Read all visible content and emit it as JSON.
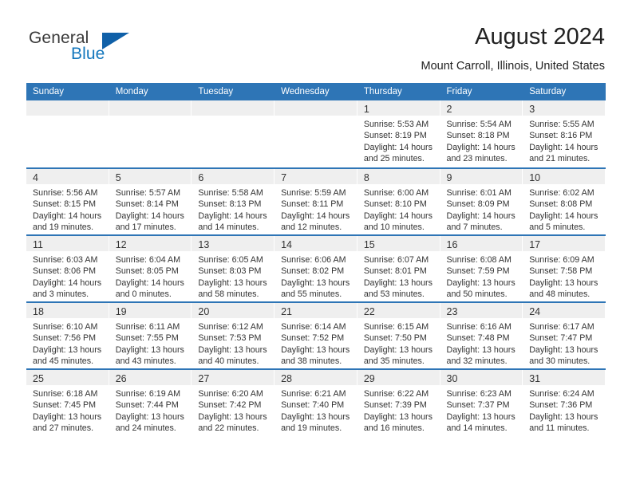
{
  "brand": {
    "name_part1": "General",
    "name_part2": "Blue",
    "mark": "triangle-logo"
  },
  "header": {
    "title": "August 2024",
    "location": "Mount Carroll, Illinois, United States"
  },
  "calendar": {
    "weekday_headers": [
      "Sunday",
      "Monday",
      "Tuesday",
      "Wednesday",
      "Thursday",
      "Friday",
      "Saturday"
    ],
    "accent_color": "#2e75b6",
    "daynum_band_color": "#efefef",
    "weeks": [
      [
        {
          "day": "",
          "lines": []
        },
        {
          "day": "",
          "lines": []
        },
        {
          "day": "",
          "lines": []
        },
        {
          "day": "",
          "lines": []
        },
        {
          "day": "1",
          "lines": [
            "Sunrise: 5:53 AM",
            "Sunset: 8:19 PM",
            "Daylight: 14 hours",
            "and 25 minutes."
          ]
        },
        {
          "day": "2",
          "lines": [
            "Sunrise: 5:54 AM",
            "Sunset: 8:18 PM",
            "Daylight: 14 hours",
            "and 23 minutes."
          ]
        },
        {
          "day": "3",
          "lines": [
            "Sunrise: 5:55 AM",
            "Sunset: 8:16 PM",
            "Daylight: 14 hours",
            "and 21 minutes."
          ]
        }
      ],
      [
        {
          "day": "4",
          "lines": [
            "Sunrise: 5:56 AM",
            "Sunset: 8:15 PM",
            "Daylight: 14 hours",
            "and 19 minutes."
          ]
        },
        {
          "day": "5",
          "lines": [
            "Sunrise: 5:57 AM",
            "Sunset: 8:14 PM",
            "Daylight: 14 hours",
            "and 17 minutes."
          ]
        },
        {
          "day": "6",
          "lines": [
            "Sunrise: 5:58 AM",
            "Sunset: 8:13 PM",
            "Daylight: 14 hours",
            "and 14 minutes."
          ]
        },
        {
          "day": "7",
          "lines": [
            "Sunrise: 5:59 AM",
            "Sunset: 8:11 PM",
            "Daylight: 14 hours",
            "and 12 minutes."
          ]
        },
        {
          "day": "8",
          "lines": [
            "Sunrise: 6:00 AM",
            "Sunset: 8:10 PM",
            "Daylight: 14 hours",
            "and 10 minutes."
          ]
        },
        {
          "day": "9",
          "lines": [
            "Sunrise: 6:01 AM",
            "Sunset: 8:09 PM",
            "Daylight: 14 hours",
            "and 7 minutes."
          ]
        },
        {
          "day": "10",
          "lines": [
            "Sunrise: 6:02 AM",
            "Sunset: 8:08 PM",
            "Daylight: 14 hours",
            "and 5 minutes."
          ]
        }
      ],
      [
        {
          "day": "11",
          "lines": [
            "Sunrise: 6:03 AM",
            "Sunset: 8:06 PM",
            "Daylight: 14 hours",
            "and 3 minutes."
          ]
        },
        {
          "day": "12",
          "lines": [
            "Sunrise: 6:04 AM",
            "Sunset: 8:05 PM",
            "Daylight: 14 hours",
            "and 0 minutes."
          ]
        },
        {
          "day": "13",
          "lines": [
            "Sunrise: 6:05 AM",
            "Sunset: 8:03 PM",
            "Daylight: 13 hours",
            "and 58 minutes."
          ]
        },
        {
          "day": "14",
          "lines": [
            "Sunrise: 6:06 AM",
            "Sunset: 8:02 PM",
            "Daylight: 13 hours",
            "and 55 minutes."
          ]
        },
        {
          "day": "15",
          "lines": [
            "Sunrise: 6:07 AM",
            "Sunset: 8:01 PM",
            "Daylight: 13 hours",
            "and 53 minutes."
          ]
        },
        {
          "day": "16",
          "lines": [
            "Sunrise: 6:08 AM",
            "Sunset: 7:59 PM",
            "Daylight: 13 hours",
            "and 50 minutes."
          ]
        },
        {
          "day": "17",
          "lines": [
            "Sunrise: 6:09 AM",
            "Sunset: 7:58 PM",
            "Daylight: 13 hours",
            "and 48 minutes."
          ]
        }
      ],
      [
        {
          "day": "18",
          "lines": [
            "Sunrise: 6:10 AM",
            "Sunset: 7:56 PM",
            "Daylight: 13 hours",
            "and 45 minutes."
          ]
        },
        {
          "day": "19",
          "lines": [
            "Sunrise: 6:11 AM",
            "Sunset: 7:55 PM",
            "Daylight: 13 hours",
            "and 43 minutes."
          ]
        },
        {
          "day": "20",
          "lines": [
            "Sunrise: 6:12 AM",
            "Sunset: 7:53 PM",
            "Daylight: 13 hours",
            "and 40 minutes."
          ]
        },
        {
          "day": "21",
          "lines": [
            "Sunrise: 6:14 AM",
            "Sunset: 7:52 PM",
            "Daylight: 13 hours",
            "and 38 minutes."
          ]
        },
        {
          "day": "22",
          "lines": [
            "Sunrise: 6:15 AM",
            "Sunset: 7:50 PM",
            "Daylight: 13 hours",
            "and 35 minutes."
          ]
        },
        {
          "day": "23",
          "lines": [
            "Sunrise: 6:16 AM",
            "Sunset: 7:48 PM",
            "Daylight: 13 hours",
            "and 32 minutes."
          ]
        },
        {
          "day": "24",
          "lines": [
            "Sunrise: 6:17 AM",
            "Sunset: 7:47 PM",
            "Daylight: 13 hours",
            "and 30 minutes."
          ]
        }
      ],
      [
        {
          "day": "25",
          "lines": [
            "Sunrise: 6:18 AM",
            "Sunset: 7:45 PM",
            "Daylight: 13 hours",
            "and 27 minutes."
          ]
        },
        {
          "day": "26",
          "lines": [
            "Sunrise: 6:19 AM",
            "Sunset: 7:44 PM",
            "Daylight: 13 hours",
            "and 24 minutes."
          ]
        },
        {
          "day": "27",
          "lines": [
            "Sunrise: 6:20 AM",
            "Sunset: 7:42 PM",
            "Daylight: 13 hours",
            "and 22 minutes."
          ]
        },
        {
          "day": "28",
          "lines": [
            "Sunrise: 6:21 AM",
            "Sunset: 7:40 PM",
            "Daylight: 13 hours",
            "and 19 minutes."
          ]
        },
        {
          "day": "29",
          "lines": [
            "Sunrise: 6:22 AM",
            "Sunset: 7:39 PM",
            "Daylight: 13 hours",
            "and 16 minutes."
          ]
        },
        {
          "day": "30",
          "lines": [
            "Sunrise: 6:23 AM",
            "Sunset: 7:37 PM",
            "Daylight: 13 hours",
            "and 14 minutes."
          ]
        },
        {
          "day": "31",
          "lines": [
            "Sunrise: 6:24 AM",
            "Sunset: 7:36 PM",
            "Daylight: 13 hours",
            "and 11 minutes."
          ]
        }
      ]
    ]
  }
}
